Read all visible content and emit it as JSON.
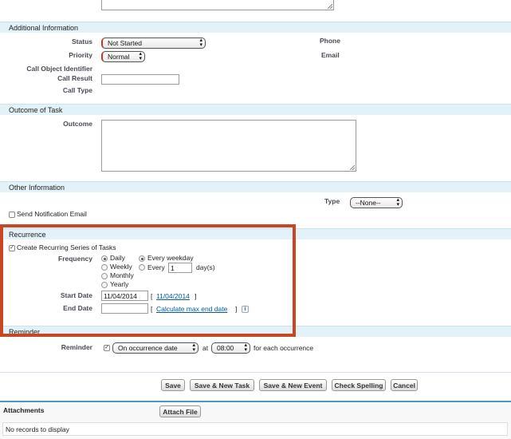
{
  "additional_info": {
    "title": "Additional Information",
    "status_label": "Status",
    "status_value": "Not Started",
    "priority_label": "Priority",
    "priority_value": "Normal",
    "call_object_label": "Call Object Identifier",
    "call_result_label": "Call Result",
    "call_type_label": "Call Type",
    "phone_label": "Phone",
    "email_label": "Email"
  },
  "outcome": {
    "title": "Outcome of Task",
    "label": "Outcome"
  },
  "other_info": {
    "title": "Other Information",
    "type_label": "Type",
    "type_value": "--None--",
    "notify_label": "Send Notification Email"
  },
  "recurrence": {
    "title": "Recurrence",
    "create_label": "Create Recurring Series of Tasks",
    "frequency_label": "Frequency",
    "freq_daily": "Daily",
    "freq_weekly": "Weekly",
    "freq_monthly": "Monthly",
    "freq_yearly": "Yearly",
    "every_weekday": "Every weekday",
    "every": "Every",
    "every_value": "1",
    "days_suffix": "day(s)",
    "start_label": "Start Date",
    "start_value": "11/04/2014",
    "bracket_open": "[",
    "bracket_close": "]",
    "start_link": "11/04/2014",
    "end_label": "End Date",
    "calc_link": "Calculate max end date",
    "info_icon_text": "i",
    "highlight_color": "#c84621"
  },
  "reminder": {
    "title": "Reminder",
    "label": "Reminder",
    "option_value": "On occurrence date",
    "at_label": "at",
    "time_value": "08:00",
    "suffix": "for each occurrence"
  },
  "buttons": {
    "save": "Save",
    "save_new_task": "Save & New Task",
    "save_new_event": "Save & New Event",
    "check_spelling": "Check Spelling",
    "cancel": "Cancel"
  },
  "attachments": {
    "title": "Attachments",
    "attach_button": "Attach File",
    "empty_text": "No records to display"
  }
}
